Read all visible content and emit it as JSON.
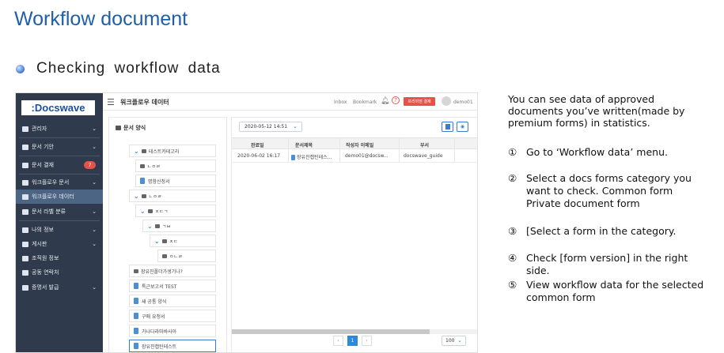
{
  "slide": {
    "title": "Workflow document",
    "subtitle": "Checking workflow data"
  },
  "app": {
    "logo": ":Docswave",
    "page_heading": "워크플로우 데이터",
    "topbar": {
      "inbox": "Inbox",
      "bookmark": "Bookmark",
      "help": "?",
      "premium_button": "프리미엄 결제",
      "user": "demo01"
    },
    "sidebar": {
      "items": [
        {
          "label": "관리자"
        },
        {
          "label": "문서 기안"
        },
        {
          "label": "문서 결재",
          "badge": "7"
        },
        {
          "label": "워크플로우 문서"
        },
        {
          "label": "워크플로우 데이터"
        },
        {
          "label": "문서 라벨 분류"
        },
        {
          "label": "나의 정보"
        },
        {
          "label": "게시판"
        },
        {
          "label": "조직원 정보"
        },
        {
          "label": "공동 연락처"
        },
        {
          "label": "증명서 발급"
        }
      ]
    },
    "tree": {
      "title": "문서 양식",
      "nodes": [
        {
          "label": "테스트카테고리"
        },
        {
          "label": "ㄴㅇㄹ"
        },
        {
          "label": "명함신청서"
        },
        {
          "label": "ㄴㅇㄹ"
        },
        {
          "label": "ㅈㄷㄱ"
        },
        {
          "label": "ㄱㅂ"
        },
        {
          "label": "ㅈㄷ"
        },
        {
          "label": "ㅇㄴㄹ"
        },
        {
          "label": "장유진폴더가생기나?"
        },
        {
          "label": "특근보고서 TEST"
        },
        {
          "label": "새 공통 양식"
        },
        {
          "label": "구매 요청서"
        },
        {
          "label": "가나다라마바사아"
        },
        {
          "label": "장유진캡틴테스트"
        }
      ]
    },
    "data_panel": {
      "version": "2020-05-12 14:51",
      "columns": [
        "완료일",
        "문서제목",
        "작성자 이메일",
        "부서"
      ],
      "rows": [
        {
          "date": "2020-06-02 16:17",
          "title": "장유진캡틴테스...",
          "email": "demo01@docsw...",
          "dept": "docswave_guide"
        }
      ],
      "pagination": {
        "prev": "‹",
        "current": "1",
        "next": "›",
        "page_size": "100"
      }
    }
  },
  "instructions": {
    "intro": [
      "You can see data of approved",
      "documents you’ve written(made  by",
      "premium  forms) in statistics."
    ],
    "steps": [
      {
        "num": "①",
        "lines": [
          "Go to ‘Workflow data’ menu."
        ]
      },
      {
        "num": "②",
        "lines": [
          "Select a docs forms  category you",
          "want to check.   Common form",
          "Private document form"
        ]
      },
      {
        "num": "③",
        "lines": [
          "[Select a form  in the category."
        ]
      },
      {
        "num": "④",
        "lines": [
          "Check [form version] in the right",
          "side."
        ]
      },
      {
        "num": "⑤",
        "lines": [
          "View workflow data for the selected",
          "common form"
        ]
      }
    ]
  }
}
